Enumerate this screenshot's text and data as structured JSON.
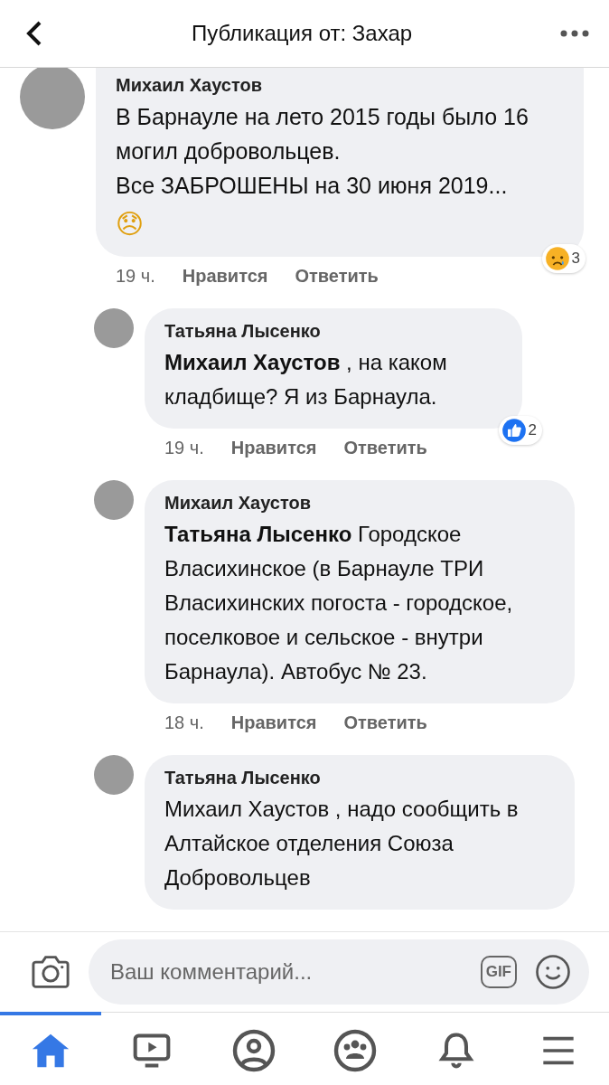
{
  "header": {
    "title": "Публикация от: Захар"
  },
  "comments": [
    {
      "author": "Михаил Хаустов",
      "text": "В Барнауле на лето 2015 годы было 16 могил добровольцев.\nВсе ЗАБРОШЕНЫ на 30 июня 2019...",
      "emoji": "😞",
      "time": "19 ч.",
      "like": "Нравится",
      "reply": "Ответить",
      "reaction": {
        "kind": "sad",
        "count": "3"
      },
      "children": [
        {
          "author": "Татьяна Лысенко",
          "text": "**Михаил Хаустов** , на каком кладбище? Я из Барнаула.",
          "time": "19 ч.",
          "like": "Нравится",
          "reply": "Ответить",
          "reaction": {
            "kind": "like",
            "count": "2"
          }
        },
        {
          "author": "Михаил Хаустов",
          "text": "**Татьяна Лысенко** Городское Власихинское (в Барнауле  ТРИ Власихинских погоста - городское, поселковое и сельское - внутри Барнаула). Автобус № 23.",
          "time": "18 ч.",
          "like": "Нравится",
          "reply": "Ответить"
        },
        {
          "author": "Татьяна Лысенко",
          "text": "Михаил Хаустов , надо сообщить в Алтайское отделения Союза Добровольцев"
        }
      ]
    }
  ],
  "composer": {
    "placeholder": "Ваш комментарий...",
    "gif_label": "GIF"
  },
  "tabs": [
    {
      "kind": "home",
      "selected": true
    },
    {
      "kind": "video",
      "selected": false
    },
    {
      "kind": "profile",
      "selected": false
    },
    {
      "kind": "groups",
      "selected": false
    },
    {
      "kind": "notifications",
      "selected": false
    },
    {
      "kind": "menu",
      "selected": false
    }
  ]
}
